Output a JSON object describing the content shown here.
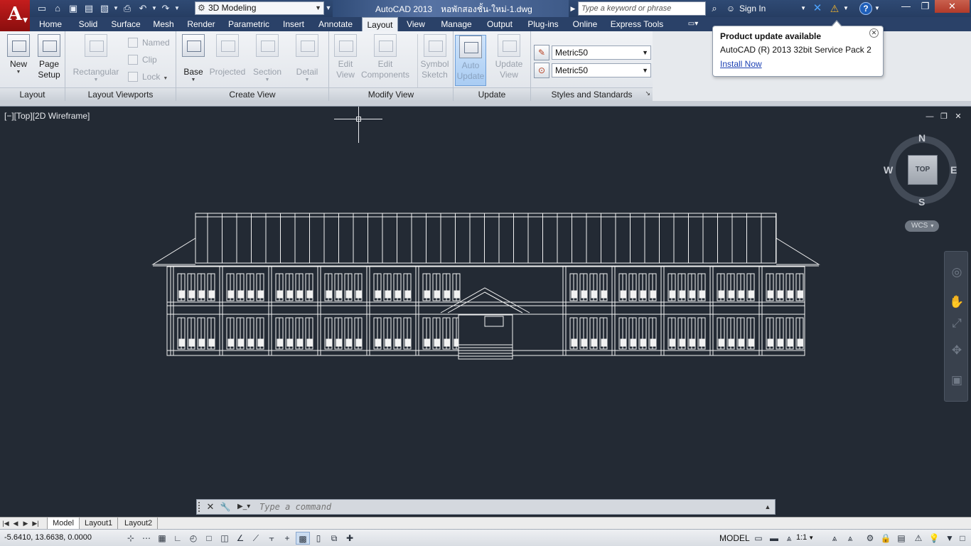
{
  "app": {
    "logo_letter": "A",
    "title": "AutoCAD 2013",
    "file_name": "หอพักสองชั้น-ใหม่-1.dwg"
  },
  "quick_access": {
    "workspace": "3D Modeling"
  },
  "search": {
    "placeholder": "Type a keyword or phrase"
  },
  "account": {
    "sign_in": "Sign In"
  },
  "ribbon_tabs": [
    "Home",
    "Solid",
    "Surface",
    "Mesh",
    "Render",
    "Parametric",
    "Insert",
    "Annotate",
    "Layout",
    "View",
    "Manage",
    "Output",
    "Plug-ins",
    "Online",
    "Express Tools"
  ],
  "active_tab": "Layout",
  "panels": {
    "layout": {
      "title": "Layout",
      "new": "New",
      "page_setup_1": "Page",
      "page_setup_2": "Setup"
    },
    "viewports": {
      "title": "Layout Viewports",
      "rectangular": "Rectangular",
      "named": "Named",
      "clip": "Clip",
      "lock": "Lock"
    },
    "create_view": {
      "title": "Create View",
      "base": "Base",
      "projected": "Projected",
      "section": "Section",
      "detail": "Detail"
    },
    "modify_view": {
      "title": "Modify View",
      "edit_view_1": "Edit",
      "edit_view_2": "View",
      "edit_components_1": "Edit",
      "edit_components_2": "Components",
      "symbol_sketch_1": "Symbol",
      "symbol_sketch_2": "Sketch"
    },
    "update": {
      "title": "Update",
      "auto_update_1": "Auto",
      "auto_update_2": "Update",
      "update_view_1": "Update",
      "update_view_2": "View"
    },
    "styles": {
      "title": "Styles and Standards",
      "style_1": "Metric50",
      "style_2": "Metric50"
    }
  },
  "notification": {
    "title": "Product update available",
    "message": "AutoCAD (R) 2013 32bit Service Pack 2",
    "link": "Install Now"
  },
  "viewport": {
    "label": "[−][Top][2D Wireframe]"
  },
  "viewcube": {
    "face": "TOP",
    "north": "N",
    "south": "S",
    "east": "E",
    "west": "W",
    "ucs": "WCS"
  },
  "command_line": {
    "placeholder": "Type a command"
  },
  "layout_tabs": [
    "Model",
    "Layout1",
    "Layout2"
  ],
  "status": {
    "coordinates": "-5.6410, 13.6638, 0.0000",
    "space": "MODEL",
    "annotation_scale": "1:1"
  }
}
